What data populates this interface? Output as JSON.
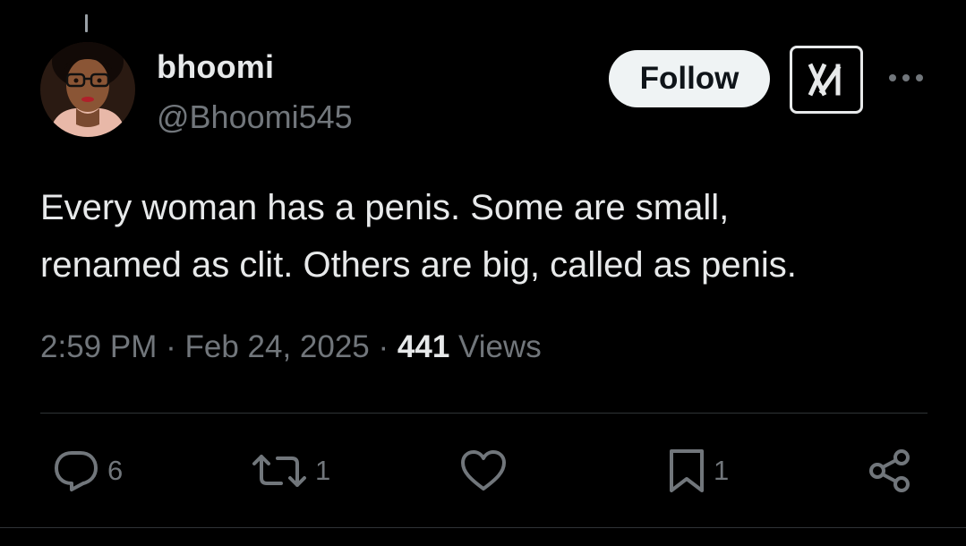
{
  "author": {
    "display_name": "bhoomi",
    "handle": "@Bhoomi545",
    "avatar_icon": "profile-photo"
  },
  "header": {
    "follow_label": "Follow",
    "grok_icon": "grok-icon",
    "more_icon": "more-icon"
  },
  "tweet": {
    "text_line_1": "Every woman has a penis. Some are small,",
    "text_line_2": "renamed as clit. Others are big, called as penis."
  },
  "meta": {
    "time": "2:59 PM",
    "separator": "·",
    "date": "Feb 24, 2025",
    "views_count": "441",
    "views_label": "Views"
  },
  "actions": {
    "replies": "6",
    "reposts": "1",
    "likes": "",
    "bookmarks": "1"
  },
  "colors": {
    "background": "#000000",
    "text_primary": "#e7e9ea",
    "text_secondary": "#71767b",
    "divider": "#2f3336",
    "follow_bg": "#eff3f4"
  }
}
